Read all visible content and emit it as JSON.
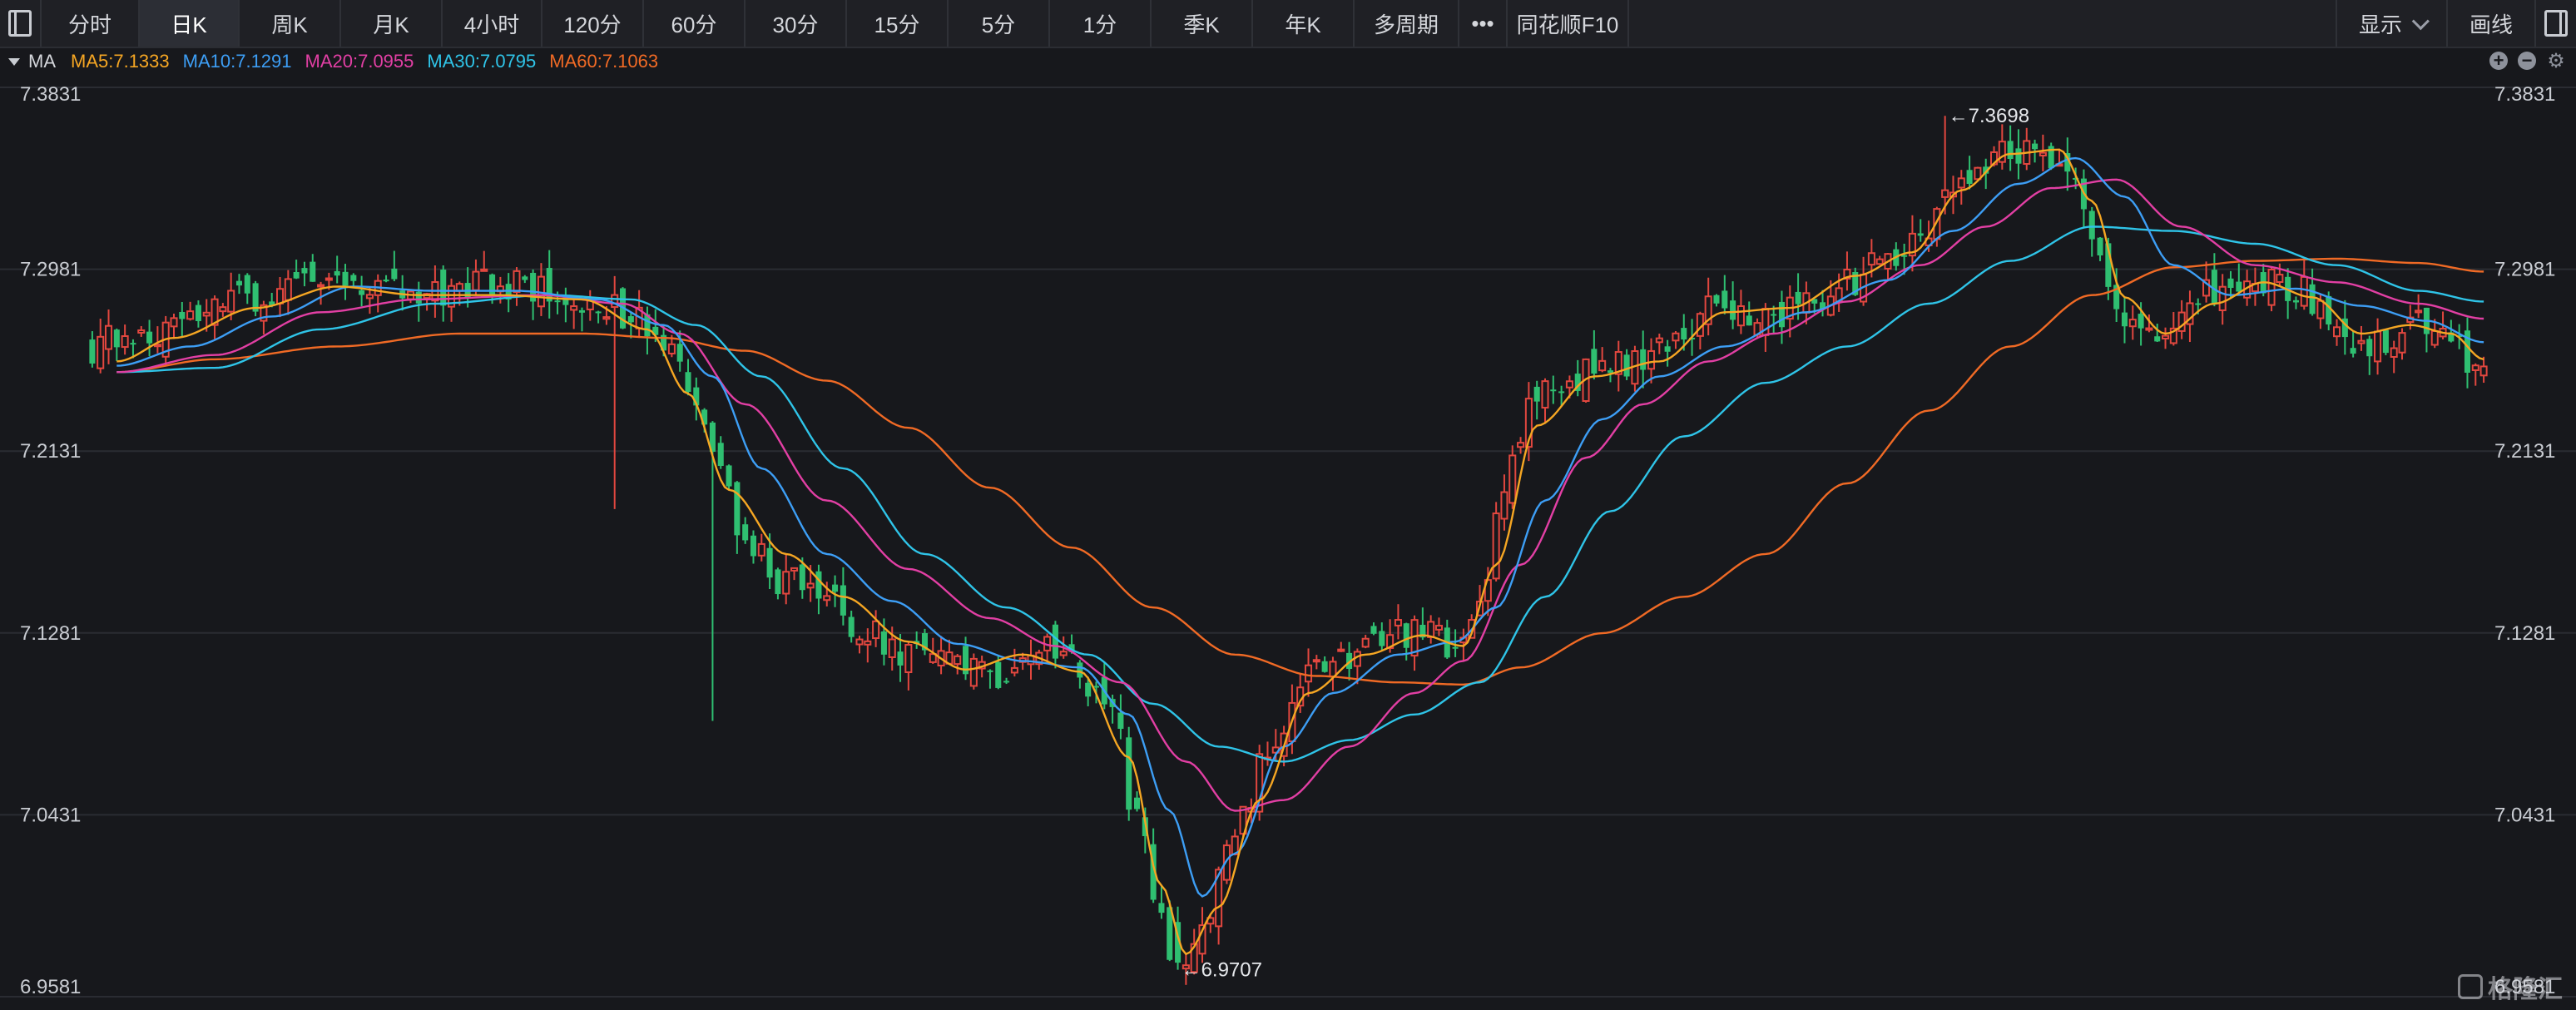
{
  "toolbar": {
    "tabs": [
      {
        "label": "分时",
        "active": false
      },
      {
        "label": "日K",
        "active": true
      },
      {
        "label": "周K",
        "active": false
      },
      {
        "label": "月K",
        "active": false
      },
      {
        "label": "4小时",
        "active": false
      },
      {
        "label": "120分",
        "active": false
      },
      {
        "label": "60分",
        "active": false
      },
      {
        "label": "30分",
        "active": false
      },
      {
        "label": "15分",
        "active": false
      },
      {
        "label": "5分",
        "active": false
      },
      {
        "label": "1分",
        "active": false
      },
      {
        "label": "季K",
        "active": false
      },
      {
        "label": "年K",
        "active": false
      },
      {
        "label": "多周期",
        "active": false
      },
      {
        "label": "•••",
        "active": false
      },
      {
        "label": "同花顺F10",
        "active": false
      }
    ],
    "display_label": "显示",
    "draw_label": "画线"
  },
  "legend": {
    "name": "MA",
    "items": [
      {
        "label": "MA5:7.1333",
        "color": "#f5a623"
      },
      {
        "label": "MA10:7.1291",
        "color": "#3d9ef5"
      },
      {
        "label": "MA20:7.0955",
        "color": "#e23fa4"
      },
      {
        "label": "MA30:7.0795",
        "color": "#2fc4e8"
      },
      {
        "label": "MA60:7.1063",
        "color": "#f06a25"
      }
    ],
    "tools": [
      "zoom-in-icon",
      "zoom-out-icon",
      "settings-gear-icon"
    ]
  },
  "watermark": "格隆汇",
  "chart_data": {
    "type": "candlestick",
    "y_ticks": [
      "7.3831",
      "7.2981",
      "7.2131",
      "7.1281",
      "7.0431",
      "6.9581"
    ],
    "ylim": [
      6.9581,
      7.3831
    ],
    "colors": {
      "up": "#e2473f",
      "down": "#2fbf71",
      "ma5": "#f5a623",
      "ma10": "#3d9ef5",
      "ma20": "#e23fa4",
      "ma30": "#2fc4e8",
      "ma60": "#f06a25"
    },
    "high_annotation": "←7.3698",
    "low_annotation": "←6.9707",
    "high_value": 7.3698,
    "low_value": 6.9707,
    "control_points": {
      "close": [
        [
          0,
          7.262
        ],
        [
          5,
          7.268
        ],
        [
          10,
          7.272
        ],
        [
          15,
          7.282
        ],
        [
          20,
          7.286
        ],
        [
          25,
          7.292
        ],
        [
          30,
          7.296
        ],
        [
          35,
          7.29
        ],
        [
          40,
          7.283
        ],
        [
          45,
          7.288
        ],
        [
          50,
          7.292
        ],
        [
          55,
          7.288
        ],
        [
          60,
          7.282
        ],
        [
          65,
          7.278
        ],
        [
          70,
          7.262
        ],
        [
          74,
          7.232
        ],
        [
          77,
          7.2
        ],
        [
          80,
          7.172
        ],
        [
          85,
          7.152
        ],
        [
          90,
          7.145
        ],
        [
          95,
          7.128
        ],
        [
          100,
          7.118
        ],
        [
          105,
          7.112
        ],
        [
          110,
          7.108
        ],
        [
          115,
          7.122
        ],
        [
          120,
          7.112
        ],
        [
          125,
          7.09
        ],
        [
          128,
          7.04
        ],
        [
          131,
          6.99
        ],
        [
          133,
          6.972
        ],
        [
          136,
          6.99
        ],
        [
          140,
          7.035
        ],
        [
          145,
          7.082
        ],
        [
          150,
          7.11
        ],
        [
          155,
          7.118
        ],
        [
          160,
          7.128
        ],
        [
          165,
          7.126
        ],
        [
          168,
          7.118
        ],
        [
          170,
          7.14
        ],
        [
          173,
          7.2
        ],
        [
          176,
          7.232
        ],
        [
          180,
          7.248
        ],
        [
          185,
          7.25
        ],
        [
          190,
          7.256
        ],
        [
          195,
          7.27
        ],
        [
          200,
          7.282
        ],
        [
          205,
          7.276
        ],
        [
          210,
          7.282
        ],
        [
          215,
          7.29
        ],
        [
          220,
          7.302
        ],
        [
          225,
          7.318
        ],
        [
          228,
          7.34
        ],
        [
          232,
          7.35
        ],
        [
          236,
          7.355
        ],
        [
          240,
          7.352
        ],
        [
          243,
          7.345
        ],
        [
          246,
          7.3
        ],
        [
          249,
          7.275
        ],
        [
          252,
          7.268
        ],
        [
          256,
          7.272
        ],
        [
          260,
          7.288
        ],
        [
          265,
          7.292
        ],
        [
          270,
          7.29
        ],
        [
          275,
          7.268
        ],
        [
          280,
          7.262
        ],
        [
          285,
          7.275
        ],
        [
          288,
          7.27
        ],
        [
          292,
          7.252
        ]
      ],
      "ma5": [
        [
          3,
          7.255
        ],
        [
          10,
          7.266
        ],
        [
          20,
          7.28
        ],
        [
          30,
          7.29
        ],
        [
          40,
          7.286
        ],
        [
          50,
          7.286
        ],
        [
          60,
          7.284
        ],
        [
          68,
          7.27
        ],
        [
          73,
          7.24
        ],
        [
          78,
          7.195
        ],
        [
          85,
          7.165
        ],
        [
          92,
          7.145
        ],
        [
          100,
          7.124
        ],
        [
          107,
          7.111
        ],
        [
          114,
          7.118
        ],
        [
          121,
          7.11
        ],
        [
          127,
          7.07
        ],
        [
          131,
          7.01
        ],
        [
          134,
          6.978
        ],
        [
          138,
          7.0
        ],
        [
          143,
          7.05
        ],
        [
          149,
          7.1
        ],
        [
          156,
          7.118
        ],
        [
          163,
          7.127
        ],
        [
          168,
          7.122
        ],
        [
          172,
          7.16
        ],
        [
          177,
          7.225
        ],
        [
          184,
          7.248
        ],
        [
          192,
          7.255
        ],
        [
          200,
          7.278
        ],
        [
          208,
          7.28
        ],
        [
          216,
          7.295
        ],
        [
          223,
          7.306
        ],
        [
          229,
          7.335
        ],
        [
          235,
          7.352
        ],
        [
          241,
          7.354
        ],
        [
          245,
          7.33
        ],
        [
          249,
          7.285
        ],
        [
          254,
          7.268
        ],
        [
          260,
          7.282
        ],
        [
          266,
          7.292
        ],
        [
          272,
          7.285
        ],
        [
          278,
          7.268
        ],
        [
          284,
          7.272
        ],
        [
          289,
          7.268
        ],
        [
          293,
          7.256
        ]
      ],
      "ma10": [
        [
          3,
          7.253
        ],
        [
          12,
          7.262
        ],
        [
          22,
          7.276
        ],
        [
          32,
          7.29
        ],
        [
          42,
          7.288
        ],
        [
          52,
          7.288
        ],
        [
          62,
          7.284
        ],
        [
          70,
          7.272
        ],
        [
          76,
          7.248
        ],
        [
          82,
          7.205
        ],
        [
          90,
          7.165
        ],
        [
          98,
          7.143
        ],
        [
          106,
          7.123
        ],
        [
          114,
          7.115
        ],
        [
          121,
          7.112
        ],
        [
          127,
          7.09
        ],
        [
          132,
          7.045
        ],
        [
          136,
          7.005
        ],
        [
          140,
          7.025
        ],
        [
          146,
          7.075
        ],
        [
          152,
          7.1
        ],
        [
          160,
          7.118
        ],
        [
          167,
          7.124
        ],
        [
          172,
          7.14
        ],
        [
          178,
          7.19
        ],
        [
          185,
          7.228
        ],
        [
          192,
          7.248
        ],
        [
          200,
          7.262
        ],
        [
          210,
          7.278
        ],
        [
          220,
          7.293
        ],
        [
          228,
          7.316
        ],
        [
          236,
          7.338
        ],
        [
          243,
          7.35
        ],
        [
          249,
          7.332
        ],
        [
          255,
          7.3
        ],
        [
          262,
          7.286
        ],
        [
          270,
          7.289
        ],
        [
          278,
          7.281
        ],
        [
          286,
          7.274
        ],
        [
          293,
          7.264
        ]
      ],
      "ma20": [
        [
          3,
          7.25
        ],
        [
          15,
          7.258
        ],
        [
          28,
          7.278
        ],
        [
          40,
          7.284
        ],
        [
          55,
          7.286
        ],
        [
          65,
          7.282
        ],
        [
          72,
          7.268
        ],
        [
          80,
          7.235
        ],
        [
          90,
          7.19
        ],
        [
          100,
          7.158
        ],
        [
          110,
          7.135
        ],
        [
          118,
          7.122
        ],
        [
          126,
          7.105
        ],
        [
          134,
          7.068
        ],
        [
          140,
          7.045
        ],
        [
          146,
          7.05
        ],
        [
          154,
          7.075
        ],
        [
          162,
          7.1
        ],
        [
          168,
          7.115
        ],
        [
          175,
          7.16
        ],
        [
          183,
          7.21
        ],
        [
          190,
          7.235
        ],
        [
          198,
          7.255
        ],
        [
          206,
          7.268
        ],
        [
          215,
          7.283
        ],
        [
          224,
          7.3
        ],
        [
          232,
          7.318
        ],
        [
          240,
          7.336
        ],
        [
          248,
          7.34
        ],
        [
          256,
          7.318
        ],
        [
          265,
          7.3
        ],
        [
          275,
          7.292
        ],
        [
          285,
          7.282
        ],
        [
          293,
          7.275
        ]
      ],
      "ma30": [
        [
          3,
          7.25
        ],
        [
          15,
          7.252
        ],
        [
          28,
          7.27
        ],
        [
          42,
          7.282
        ],
        [
          56,
          7.286
        ],
        [
          66,
          7.284
        ],
        [
          74,
          7.272
        ],
        [
          82,
          7.248
        ],
        [
          92,
          7.205
        ],
        [
          102,
          7.165
        ],
        [
          112,
          7.14
        ],
        [
          122,
          7.118
        ],
        [
          130,
          7.095
        ],
        [
          138,
          7.075
        ],
        [
          146,
          7.068
        ],
        [
          154,
          7.078
        ],
        [
          162,
          7.09
        ],
        [
          170,
          7.105
        ],
        [
          178,
          7.145
        ],
        [
          186,
          7.185
        ],
        [
          195,
          7.22
        ],
        [
          205,
          7.245
        ],
        [
          215,
          7.262
        ],
        [
          225,
          7.282
        ],
        [
          235,
          7.302
        ],
        [
          245,
          7.318
        ],
        [
          255,
          7.316
        ],
        [
          265,
          7.31
        ],
        [
          275,
          7.3
        ],
        [
          285,
          7.288
        ],
        [
          293,
          7.283
        ]
      ],
      "ma60": [
        [
          3,
          7.25
        ],
        [
          15,
          7.256
        ],
        [
          30,
          7.262
        ],
        [
          45,
          7.268
        ],
        [
          60,
          7.268
        ],
        [
          70,
          7.266
        ],
        [
          80,
          7.26
        ],
        [
          90,
          7.246
        ],
        [
          100,
          7.224
        ],
        [
          110,
          7.196
        ],
        [
          120,
          7.168
        ],
        [
          130,
          7.14
        ],
        [
          140,
          7.118
        ],
        [
          150,
          7.108
        ],
        [
          160,
          7.105
        ],
        [
          168,
          7.104
        ],
        [
          175,
          7.112
        ],
        [
          185,
          7.128
        ],
        [
          195,
          7.145
        ],
        [
          205,
          7.165
        ],
        [
          215,
          7.198
        ],
        [
          225,
          7.232
        ],
        [
          235,
          7.262
        ],
        [
          245,
          7.286
        ],
        [
          255,
          7.299
        ],
        [
          265,
          7.302
        ],
        [
          275,
          7.303
        ],
        [
          285,
          7.301
        ],
        [
          293,
          7.297
        ]
      ]
    }
  }
}
